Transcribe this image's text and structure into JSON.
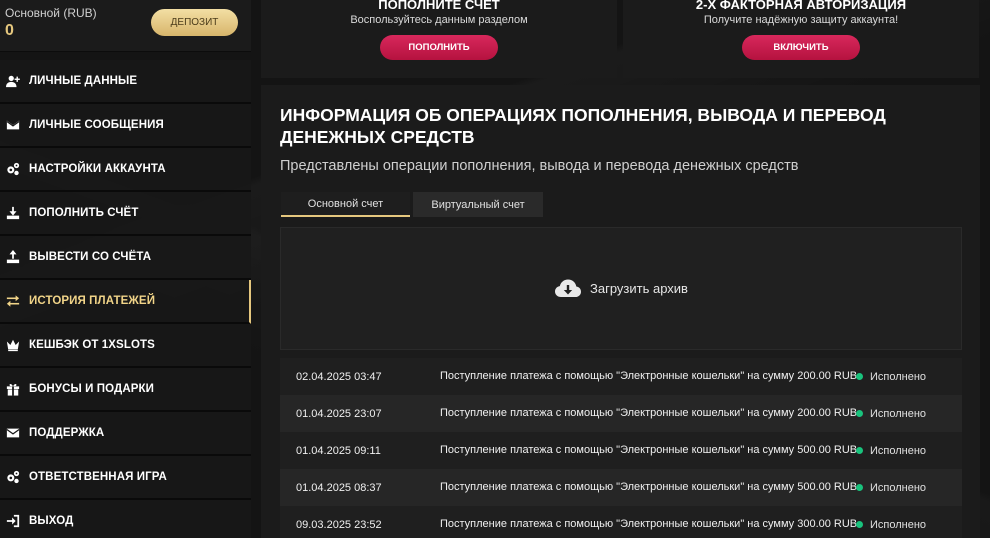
{
  "balance": {
    "label": "Основной (RUB)",
    "value": "0",
    "deposit_label": "ДЕПОЗИТ"
  },
  "menu": [
    {
      "label": "ЛИЧНЫЕ ДАННЫЕ",
      "icon": "user-plus-icon"
    },
    {
      "label": "ЛИЧНЫЕ СООБЩЕНИЯ",
      "icon": "envelope-icon"
    },
    {
      "label": "НАСТРОЙКИ АККАУНТА",
      "icon": "gears-icon"
    },
    {
      "label": "ПОПОЛНИТЬ СЧЁТ",
      "icon": "download-icon"
    },
    {
      "label": "ВЫВЕСТИ СО СЧЁТА",
      "icon": "upload-icon"
    },
    {
      "label": "ИСТОРИЯ ПЛАТЕЖЕЙ",
      "icon": "exchange-icon",
      "active": true
    },
    {
      "label": "КЕШБЭК ОТ 1XSLOTS",
      "icon": "crown-icon"
    },
    {
      "label": "БОНУСЫ И ПОДАРКИ",
      "icon": "gift-icon"
    },
    {
      "label": "ПОДДЕРЖКА",
      "icon": "envelope-icon"
    },
    {
      "label": "ОТВЕТСТВЕННАЯ ИГРА",
      "icon": "gears-icon"
    },
    {
      "label": "ВЫХОД",
      "icon": "logout-icon"
    }
  ],
  "promos": [
    {
      "title": "ПОПОЛНИТЕ СЧЕТ",
      "subtitle": "Воспользуйтесь данным разделом",
      "button": "ПОПОЛНИТЬ"
    },
    {
      "title": "2-Х ФАКТОРНАЯ АВТОРИЗАЦИЯ",
      "subtitle": "Получите надёжную защиту аккаунта!",
      "button": "ВКЛЮЧИТЬ"
    }
  ],
  "main": {
    "heading": "ИНФОРМАЦИЯ ОБ ОПЕРАЦИЯХ ПОПОЛНЕНИЯ, ВЫВОДА И ПЕРЕВОД ДЕНЕЖНЫХ СРЕДСТВ",
    "subheading": "Представлены операции пополнения, вывода и перевода денежных средств",
    "tabs": [
      "Основной счет",
      "Виртуальный счет"
    ],
    "archive_label": "Загрузить архив"
  },
  "operations": [
    {
      "date": "02.04.2025 03:47",
      "desc": "Поступление платежа с помощью \"Электронные кошельки\" на сумму 200.00 RUB",
      "status": "Исполнено"
    },
    {
      "date": "01.04.2025 23:07",
      "desc": "Поступление платежа с помощью \"Электронные кошельки\" на сумму 200.00 RUB",
      "status": "Исполнено"
    },
    {
      "date": "01.04.2025 09:11",
      "desc": "Поступление платежа с помощью \"Электронные кошельки\" на сумму 500.00 RUB",
      "status": "Исполнено"
    },
    {
      "date": "01.04.2025 08:37",
      "desc": "Поступление платежа с помощью \"Электронные кошельки\" на сумму 500.00 RUB",
      "status": "Исполнено"
    },
    {
      "date": "09.03.2025 23:52",
      "desc": "Поступление платежа с помощью \"Электронные кошельки\" на сумму 300.00 RUB",
      "status": "Исполнено"
    }
  ],
  "colors": {
    "accent": "#e5c77e",
    "button": "#c81a4d",
    "status_ok": "#19c37d"
  }
}
